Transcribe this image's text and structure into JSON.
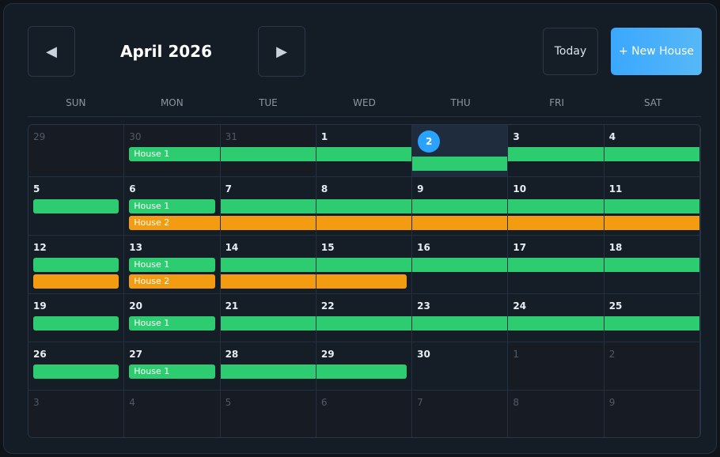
{
  "header": {
    "month_label": "April 2026",
    "today_label": "Today",
    "new_house_label": "+ New House"
  },
  "weekdays": [
    "SUN",
    "MON",
    "TUE",
    "WED",
    "THU",
    "FRI",
    "SAT"
  ],
  "days": {
    "w0": [
      "29",
      "30",
      "31",
      "1",
      "2",
      "3",
      "4"
    ],
    "w1": [
      "5",
      "6",
      "7",
      "8",
      "9",
      "10",
      "11"
    ],
    "w2": [
      "12",
      "13",
      "14",
      "15",
      "16",
      "17",
      "18"
    ],
    "w3": [
      "19",
      "20",
      "21",
      "22",
      "23",
      "24",
      "25"
    ],
    "w4": [
      "26",
      "27",
      "28",
      "29",
      "30",
      "1",
      "2"
    ],
    "w5": [
      "3",
      "4",
      "5",
      "6",
      "7",
      "8",
      "9"
    ]
  },
  "events": {
    "house1": "House 1",
    "house2": "House 2"
  },
  "colors": {
    "house1": "#2ecc71",
    "house2": "#f39c12",
    "today": "#2aa2ff",
    "accent": "#3aa8ff"
  }
}
